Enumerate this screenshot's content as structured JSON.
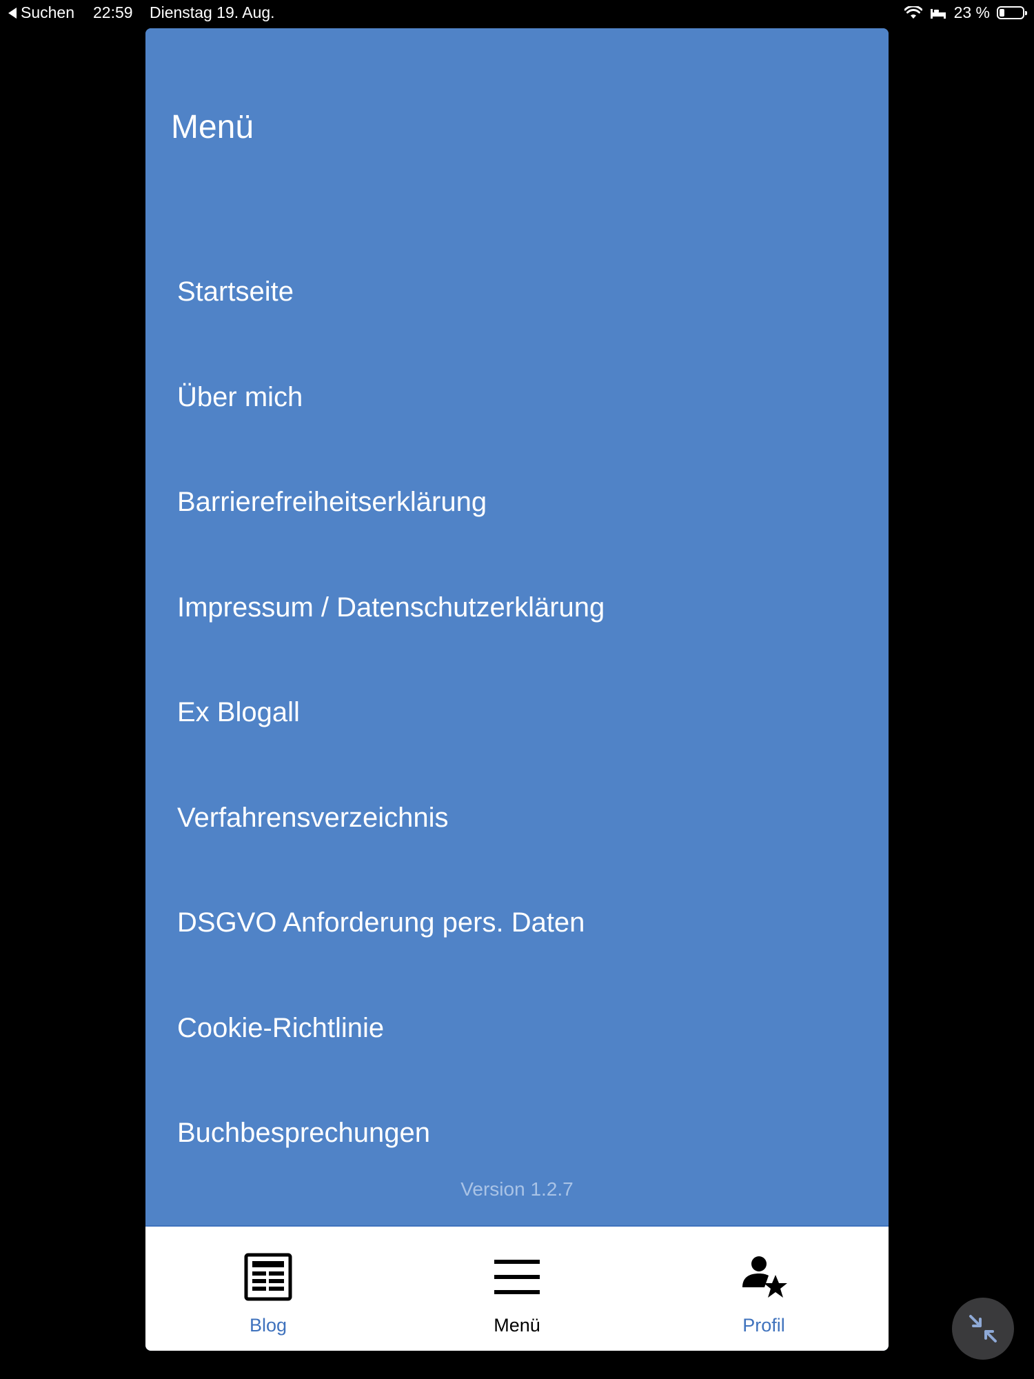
{
  "statusbar": {
    "back_label": "Suchen",
    "time": "22:59",
    "date": "Dienstag 19. Aug.",
    "battery_text": "23 %",
    "battery_level": 0.23
  },
  "menu": {
    "title": "Menü",
    "items": [
      {
        "label": "Startseite"
      },
      {
        "label": "Über mich"
      },
      {
        "label": "Barrierefreiheitserklärung"
      },
      {
        "label": "Impressum / Datenschutzerklärung"
      },
      {
        "label": "Ex Blogall"
      },
      {
        "label": "Verfahrensverzeichnis"
      },
      {
        "label": "DSGVO Anforderung pers. Daten"
      },
      {
        "label": "Cookie-Richtlinie"
      },
      {
        "label": "Buchbesprechungen"
      }
    ],
    "version": "Version 1.2.7"
  },
  "tabbar": {
    "tabs": [
      {
        "label": "Blog",
        "icon": "newspaper-icon",
        "color": "#3f72bd"
      },
      {
        "label": "Menü",
        "icon": "hamburger-menu-icon",
        "color": "#000000",
        "active": true
      },
      {
        "label": "Profil",
        "icon": "user-star-icon",
        "color": "#3f72bd"
      }
    ]
  },
  "colors": {
    "panel": "#5083c7",
    "accent": "#3f72bd",
    "version_text": "#a9c3e6"
  },
  "fab": {
    "icon": "minimize-arrows-icon"
  }
}
